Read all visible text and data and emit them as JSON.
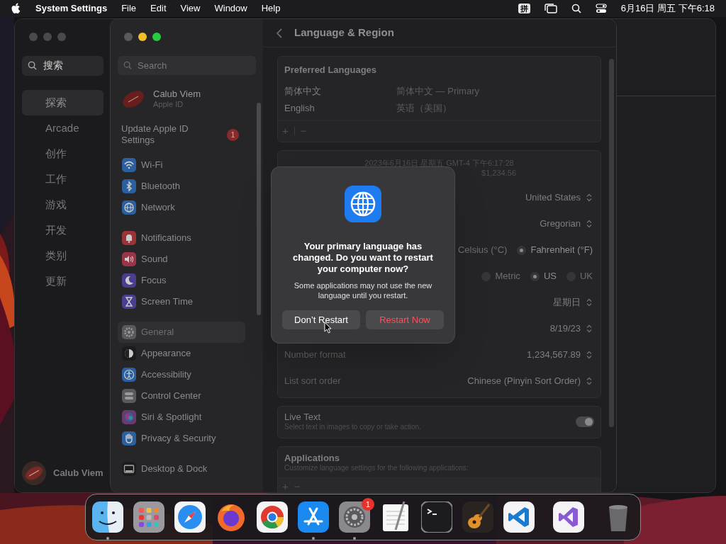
{
  "menu_bar": {
    "app_name": "System Settings",
    "menus": [
      "File",
      "Edit",
      "View",
      "Window",
      "Help"
    ],
    "input_method": "拼",
    "clock": "6月16日 周五 下午6:18"
  },
  "app_store_window": {
    "search": {
      "value": "搜索"
    },
    "items": [
      {
        "label": "探索",
        "selected": true
      },
      {
        "label": "Arcade",
        "selected": false
      },
      {
        "label": "创作",
        "selected": false
      },
      {
        "label": "工作",
        "selected": false
      },
      {
        "label": "游戏",
        "selected": false
      },
      {
        "label": "开发",
        "selected": false
      },
      {
        "label": "类别",
        "selected": false
      },
      {
        "label": "更新",
        "selected": false
      }
    ],
    "user_name": "Calub Viem"
  },
  "settings_window": {
    "search": {
      "placeholder": "Search"
    },
    "account": {
      "name": "Calub Viem",
      "subtitle": "Apple ID"
    },
    "update_notice": {
      "label": "Update Apple ID Settings",
      "badge": "1"
    },
    "sidebar_groups": [
      {
        "items": [
          {
            "label": "Wi-Fi",
            "kind": "wifi",
            "color": "#2c5f9e",
            "selected": false
          },
          {
            "label": "Bluetooth",
            "kind": "bluetooth",
            "color": "#2c5f9e",
            "selected": false
          },
          {
            "label": "Network",
            "kind": "network",
            "color": "#2c5f9e",
            "selected": false
          }
        ]
      },
      {
        "items": [
          {
            "label": "Notifications",
            "kind": "notifications",
            "color": "#9a3436",
            "selected": false
          },
          {
            "label": "Sound",
            "kind": "sound",
            "color": "#9a3446",
            "selected": false
          },
          {
            "label": "Focus",
            "kind": "focus",
            "color": "#4a3f8e",
            "selected": false
          },
          {
            "label": "Screen Time",
            "kind": "screentime",
            "color": "#4a3f8e",
            "selected": false
          }
        ]
      },
      {
        "items": [
          {
            "label": "General",
            "kind": "general",
            "color": "#5a5a5e",
            "selected": true
          },
          {
            "label": "Appearance",
            "kind": "appearance",
            "color": "#1c1c1e",
            "selected": false
          },
          {
            "label": "Accessibility",
            "kind": "accessibility",
            "color": "#2c5f9e",
            "selected": false
          },
          {
            "label": "Control Center",
            "kind": "control",
            "color": "#5a5a5e",
            "selected": false
          },
          {
            "label": "Siri & Spotlight",
            "kind": "siri",
            "color": "#6a3a6e",
            "selected": false
          },
          {
            "label": "Privacy & Security",
            "kind": "privacy",
            "color": "#2c5f9e",
            "selected": false
          }
        ]
      },
      {
        "items": [
          {
            "label": "Desktop & Dock",
            "kind": "desktop",
            "color": "#1c1c1e",
            "selected": false
          }
        ]
      }
    ],
    "page": {
      "title": "Language & Region",
      "preferred_languages": {
        "title": "Preferred Languages",
        "rows": [
          {
            "name": "简体中文",
            "detail": "简体中文 — Primary"
          },
          {
            "name": "English",
            "detail": "英语（美国）"
          }
        ],
        "add": "+",
        "remove": "−"
      },
      "region_card": {
        "preview_lines": [
          "2023年6月16日 星期五 GMT-4 下午6:17:28",
          "$1,234.56"
        ],
        "rows": [
          {
            "kind": "popup",
            "value": "United States"
          },
          {
            "kind": "popup",
            "value": "Gregorian"
          },
          {
            "kind": "radio",
            "options": [
              {
                "label": "Celsius (°C)",
                "selected": false
              },
              {
                "label": "Fahrenheit (°F)",
                "selected": true
              }
            ]
          },
          {
            "kind": "radio",
            "options": [
              {
                "label": "Metric",
                "selected": false
              },
              {
                "label": "US",
                "selected": true
              },
              {
                "label": "UK",
                "selected": false
              }
            ]
          },
          {
            "kind": "popup",
            "value": "星期日"
          },
          {
            "kind": "popup",
            "value": "8/19/23"
          },
          {
            "kind": "popup",
            "label": "Number format",
            "value": "1,234,567.89"
          },
          {
            "kind": "popup",
            "label": "List sort order",
            "value": "Chinese (Pinyin Sort Order)"
          }
        ]
      },
      "live_text": {
        "title": "Live Text",
        "subtitle": "Select text in images to copy or take action.",
        "on": true
      },
      "applications": {
        "title": "Applications",
        "subtitle": "Customize language settings for the following applications:",
        "add": "+",
        "remove": "−"
      }
    }
  },
  "dialog": {
    "title": "Your primary language has changed. Do you want to restart your computer now?",
    "message": "Some applications may not use the new language until you restart.",
    "buttons": [
      {
        "label": "Don’t Restart",
        "kind": "cancel"
      },
      {
        "label": "Restart Now",
        "kind": "destructive"
      }
    ]
  },
  "dock": {
    "apps": [
      {
        "kind": "finder",
        "running": true
      },
      {
        "kind": "launchpad",
        "running": false
      },
      {
        "kind": "safari",
        "running": false
      },
      {
        "kind": "firefox",
        "running": false
      },
      {
        "kind": "chrome",
        "running": false
      },
      {
        "kind": "appstore",
        "running": true
      },
      {
        "kind": "settings",
        "running": true,
        "badge": "1"
      },
      {
        "kind": "textedit",
        "running": false
      },
      {
        "kind": "terminal",
        "running": false
      },
      {
        "kind": "garageband",
        "running": false
      },
      {
        "kind": "vscode",
        "running": false
      },
      {
        "kind": "separator"
      },
      {
        "kind": "visualstudio",
        "running": false
      },
      {
        "kind": "separator"
      },
      {
        "kind": "trash",
        "running": false
      }
    ]
  }
}
